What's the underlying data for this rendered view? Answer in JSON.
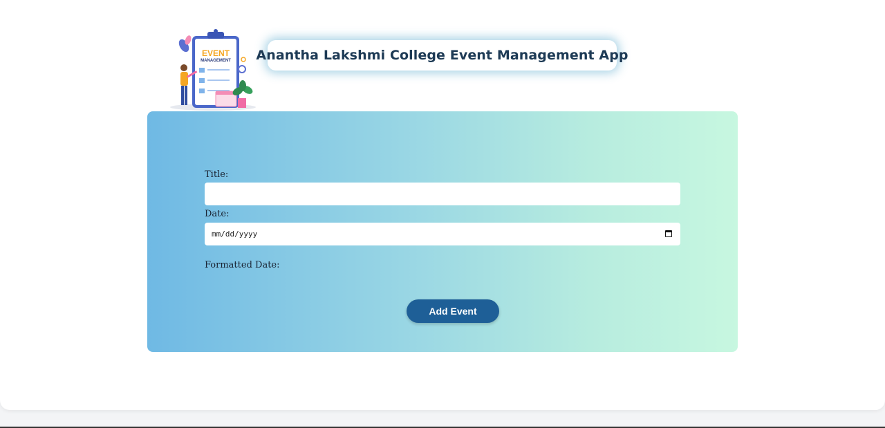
{
  "header": {
    "title": "Anantha Lakshmi College Event Management App",
    "logo": {
      "icon": "event-management-clipboard-illustration",
      "line1": "EVENT",
      "line2": "MANAGEMENT"
    }
  },
  "form": {
    "title_label": "Title:",
    "title_value": "",
    "date_label": "Date:",
    "date_placeholder": "mm/dd/yyyy",
    "formatted_date_label": "Formatted Date:",
    "formatted_date_value": "",
    "submit_label": "Add Event"
  },
  "colors": {
    "gradient_start": "#6fb9e4",
    "gradient_end": "#c7f7e0",
    "button": "#1e5f97",
    "title_text": "#1d3a55"
  }
}
